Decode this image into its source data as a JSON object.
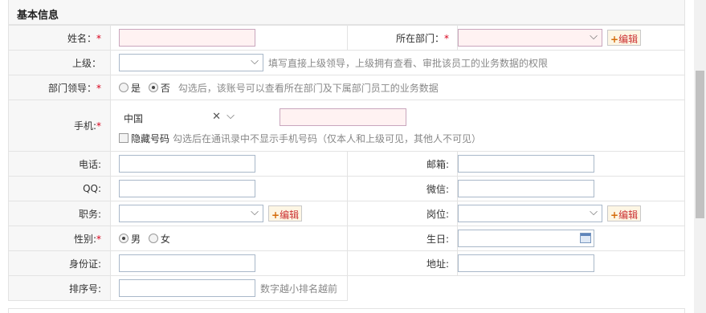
{
  "section": {
    "title": "基本信息"
  },
  "fields": {
    "name_label": "姓名：",
    "dept_label": "所在部门：",
    "superior_label": "上级：",
    "superior_hint": "填写直接上级领导，上级拥有查看、审批该员工的业务数据的权限",
    "leader_label": "部门领导：",
    "leader_yes": "是",
    "leader_no": "否",
    "leader_selected": "否",
    "leader_hint": "勾选后，该账号可以查看所在部门及下属部门员工的业务数据",
    "mobile_label": "手机:",
    "mobile_country": "中国",
    "hide_number_label": "隐藏号码",
    "hide_number_hint": "勾选后在通讯录中不显示手机号码（仅本人和上级可见，其他人不可见）",
    "phone_label": "电话:",
    "email_label": "邮箱:",
    "qq_label": "QQ:",
    "wechat_label": "微信:",
    "title_label": "职务:",
    "post_label": "岗位:",
    "gender_label": "性别:",
    "gender_male": "男",
    "gender_female": "女",
    "gender_selected": "男",
    "birthday_label": "生日:",
    "idcard_label": "身份证:",
    "address_label": "地址:",
    "sort_label": "排序号:",
    "sort_hint": "数字越小排名越前"
  },
  "buttons": {
    "edit": "编辑",
    "edit_plus": "+"
  },
  "required_mark": "*",
  "icons": {
    "dropdown": "chevron-down-icon",
    "clear": "close-icon",
    "calendar": "calendar-icon"
  },
  "colors": {
    "required": "#d9001b",
    "error_bg": "#fff2f2",
    "edit_text": "#cc3333"
  }
}
